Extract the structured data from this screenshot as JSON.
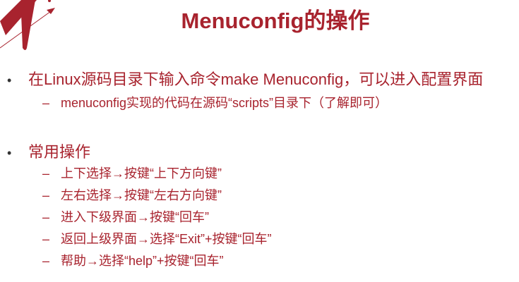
{
  "title": "Menuconfig的操作",
  "sections": [
    {
      "text": "在Linux源码目录下输入命令make Menuconfig，可以进入配置界面",
      "subs": [
        "menuconfig实现的代码在源码“scripts”目录下（了解即可）"
      ]
    },
    {
      "text": "常用操作",
      "subs": [
        "上下选择→按键“上下方向键”",
        "左右选择→按键“左右方向键”",
        "进入下级界面→按键“回车”",
        "返回上级界面→选择“Exit”+按键“回车”",
        "帮助→选择“help”+按键“回车”"
      ]
    }
  ],
  "markers": {
    "bullet": "•",
    "dash": "–"
  },
  "colors": {
    "accent": "#a8232e"
  }
}
